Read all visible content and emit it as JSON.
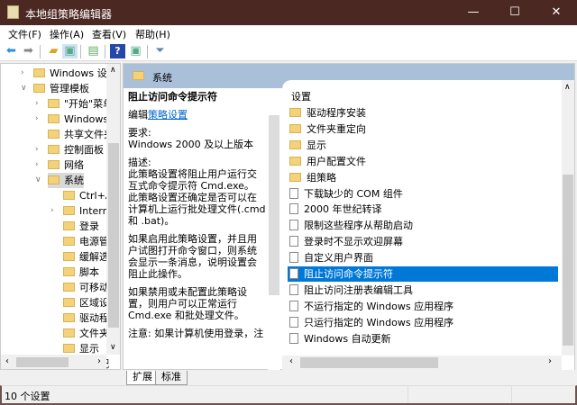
{
  "window": {
    "title": "本地组策略编辑器",
    "minimize": "—",
    "maximize": "☐",
    "close": "✕"
  },
  "menu": [
    "文件(F)",
    "操作(A)",
    "查看(V)",
    "帮助(H)"
  ],
  "toolbar": {
    "icons": [
      "back-icon",
      "forward-icon",
      "up-folder-icon",
      "show-hide-tree-icon",
      "export-list-icon",
      "help-icon",
      "show-hide-action-pane-icon",
      "filter-icon"
    ]
  },
  "tree": {
    "items": [
      {
        "label": "Windows 设置",
        "level": 1,
        "arrow": ">"
      },
      {
        "label": "管理模板",
        "level": 1,
        "arrow": "v"
      },
      {
        "label": "\"开始\"菜单",
        "level": 2,
        "arrow": ">"
      },
      {
        "label": "Windows",
        "level": 2,
        "arrow": ">"
      },
      {
        "label": "共享文件夹",
        "level": 2,
        "arrow": ""
      },
      {
        "label": "控制面板",
        "level": 2,
        "arrow": ">"
      },
      {
        "label": "网络",
        "level": 2,
        "arrow": ">"
      },
      {
        "label": "系统",
        "level": 2,
        "arrow": "v",
        "selected": true
      },
      {
        "label": "Ctrl+A",
        "level": 3,
        "arrow": ""
      },
      {
        "label": "Intern",
        "level": 3,
        "arrow": ">"
      },
      {
        "label": "登录",
        "level": 3,
        "arrow": ""
      },
      {
        "label": "电源管",
        "level": 3,
        "arrow": ""
      },
      {
        "label": "缓解选",
        "level": 3,
        "arrow": ""
      },
      {
        "label": "脚本",
        "level": 3,
        "arrow": ""
      },
      {
        "label": "可移动",
        "level": 3,
        "arrow": ""
      },
      {
        "label": "区域设",
        "level": 3,
        "arrow": ""
      },
      {
        "label": "驱动程",
        "level": 3,
        "arrow": ""
      },
      {
        "label": "文件夹",
        "level": 3,
        "arrow": ""
      },
      {
        "label": "显示",
        "level": 3,
        "arrow": ""
      },
      {
        "label": "用户配",
        "level": 3,
        "arrow": ""
      }
    ]
  },
  "pane": {
    "header": "系统",
    "desc": {
      "title": "阻止访问命令提示符",
      "edit_prefix": "编辑",
      "edit_link": "策略设置",
      "req_label": "要求:",
      "req_value": "Windows 2000 及以上版本",
      "desc_label": "描述:",
      "p1": "此策略设置将阻止用户运行交互式命令提示符 Cmd.exe。 此策略设置还确定是否可以在计算机上运行批处理文件(.cmd 和 .bat)。",
      "p2": "如果启用此策略设置，并且用户试图打开命令窗口，则系统会显示一条消息，说明设置会阻止此操作。",
      "p3": "如果禁用或未配置此策略设置，则用户可以正常运行 Cmd.exe 和批处理文件。",
      "p4": "注意: 如果计算机使用登录，注"
    },
    "list_header": "设置",
    "list": [
      {
        "label": "驱动程序安装",
        "type": "folder"
      },
      {
        "label": "文件夹重定向",
        "type": "folder"
      },
      {
        "label": "显示",
        "type": "folder"
      },
      {
        "label": "用户配置文件",
        "type": "folder"
      },
      {
        "label": "组策略",
        "type": "folder"
      },
      {
        "label": "下载缺少的 COM 组件",
        "type": "setting"
      },
      {
        "label": "2000 年世纪转译",
        "type": "setting"
      },
      {
        "label": "限制这些程序从帮助启动",
        "type": "setting"
      },
      {
        "label": "登录时不显示欢迎屏幕",
        "type": "setting"
      },
      {
        "label": "自定义用户界面",
        "type": "setting"
      },
      {
        "label": "阻止访问命令提示符",
        "type": "setting",
        "selected": true
      },
      {
        "label": "阻止访问注册表编辑工具",
        "type": "setting"
      },
      {
        "label": "不运行指定的 Windows 应用程序",
        "type": "setting"
      },
      {
        "label": "只运行指定的 Windows 应用程序",
        "type": "setting"
      },
      {
        "label": "Windows 自动更新",
        "type": "setting"
      }
    ]
  },
  "tabs": [
    "扩展",
    "标准"
  ],
  "status": "10 个设置"
}
